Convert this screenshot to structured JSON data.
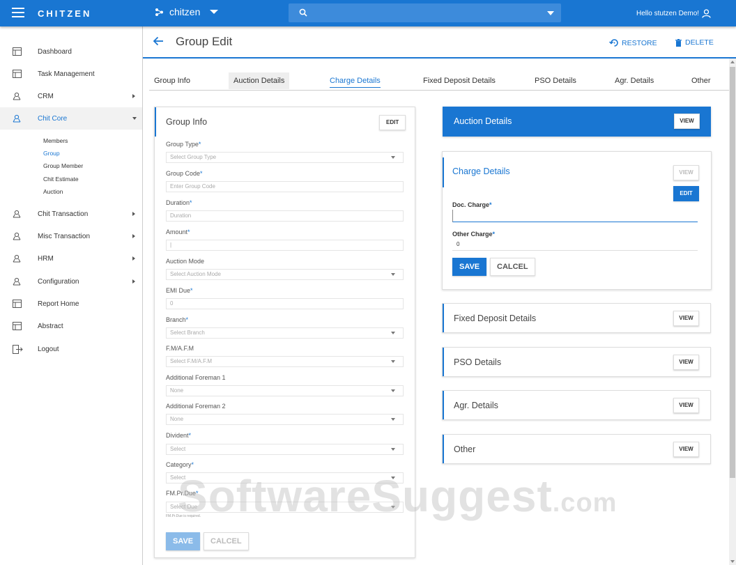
{
  "topbar": {
    "brand": "CHITZEN",
    "org_name": "chitzen",
    "search_placeholder": "",
    "greeting": "Hello stutzen Demo!"
  },
  "sidebar": {
    "items": [
      {
        "label": "Dashboard"
      },
      {
        "label": "Task Management"
      },
      {
        "label": "CRM"
      },
      {
        "label": "Chit Core"
      },
      {
        "label": "Chit Transaction"
      },
      {
        "label": "Misc Transaction"
      },
      {
        "label": "HRM"
      },
      {
        "label": "Configuration"
      },
      {
        "label": "Report Home"
      },
      {
        "label": "Abstract"
      },
      {
        "label": "Logout"
      }
    ],
    "chit_core_sub": [
      "Members",
      "Group",
      "Group Member",
      "Chit Estimate",
      "Auction"
    ]
  },
  "header": {
    "title": "Group Edit",
    "restore_label": "RESTORE",
    "delete_label": "DELETE"
  },
  "tabs": [
    "Group Info",
    "Auction Details",
    "Charge Details",
    "Fixed Deposit Details",
    "PSO Details",
    "Agr. Details",
    "Other"
  ],
  "group_info": {
    "title": "Group Info",
    "edit_label": "EDIT",
    "fields": [
      {
        "label": "Group Type",
        "req": "*",
        "value": "Select Group Type"
      },
      {
        "label": "Group Code",
        "req": "*",
        "value": "Enter Group Code"
      },
      {
        "label": "Duration",
        "req": "*",
        "value": "Duration"
      },
      {
        "label": "Amount",
        "req": "*",
        "value": "|"
      },
      {
        "label": "Auction Mode",
        "req": "",
        "value": "Select Auction Mode"
      },
      {
        "label": "EMI Due",
        "req": "*",
        "value": "0"
      },
      {
        "label": "Branch",
        "req": "*",
        "value": "Select Branch"
      },
      {
        "label": "F.M/A.F.M",
        "req": "",
        "value": "Select F.M/A.F.M"
      },
      {
        "label": "Additional Foreman 1",
        "req": "",
        "value": "None"
      },
      {
        "label": "Additional Foreman 2",
        "req": "",
        "value": "None"
      },
      {
        "label": "Divident",
        "req": "*",
        "value": "Select"
      },
      {
        "label": "Category",
        "req": "*",
        "value": "Select"
      },
      {
        "label": "FM.Pr.Due",
        "req": "*",
        "value": "Select Due"
      }
    ],
    "fmprdue_hint": "FM.Pr.Due is required.",
    "save_label": "SAVE",
    "cancel_label": "CALCEL"
  },
  "auction_details": {
    "title": "Auction Details",
    "view_label": "VIEW"
  },
  "charge_details": {
    "title": "Charge Details",
    "view_label": "VIEW",
    "edit_label": "EDIT",
    "doc_charge_label": "Doc. Charge",
    "doc_charge_value": "",
    "other_charge_label": "Other Charge",
    "other_charge_value": "0",
    "save_label": "SAVE",
    "cancel_label": "CALCEL"
  },
  "mini_cards": [
    {
      "title": "Fixed Deposit Details",
      "view_label": "VIEW"
    },
    {
      "title": "PSO Details",
      "view_label": "VIEW"
    },
    {
      "title": "Agr. Details",
      "view_label": "VIEW"
    },
    {
      "title": "Other",
      "view_label": "VIEW"
    }
  ],
  "watermark": {
    "text": "SoftwareSuggest",
    "suffix": ".com"
  },
  "colors": {
    "primary": "#1976d2",
    "text": "#333333"
  }
}
